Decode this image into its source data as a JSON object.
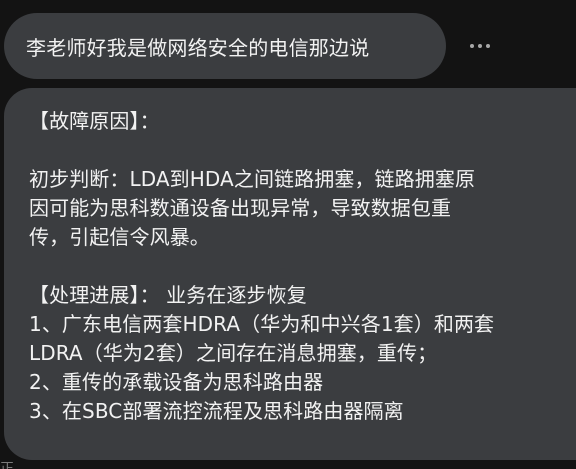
{
  "user_message": {
    "text": "李老师好我是做网络安全的电信那边说"
  },
  "more_button": {
    "icon": "more-horizontal-icon"
  },
  "assistant_message": {
    "lines": [
      "【故障原因】：",
      "",
      "初步判断：LDA到HDA之间链路拥塞，链路拥塞原",
      "因可能为思科数通设备出现异常，导致数据包重",
      "传，引起信令风暴。",
      "",
      "【处理进展】：  业务在逐步恢复",
      "1、广东电信两套HDRA（华为和中兴各1套）和两套",
      "LDRA（华为2套）之间存在消息拥塞，重传；",
      "2、重传的承载设备为思科路由器",
      "3、在SBC部署流控流程及思科路由器隔离"
    ]
  },
  "bottom_fragment": {
    "text": "正"
  },
  "colors": {
    "background": "#131313",
    "bubble": "#3b3d40",
    "text": "#f2f2f2",
    "icon": "#a7a7a7"
  }
}
